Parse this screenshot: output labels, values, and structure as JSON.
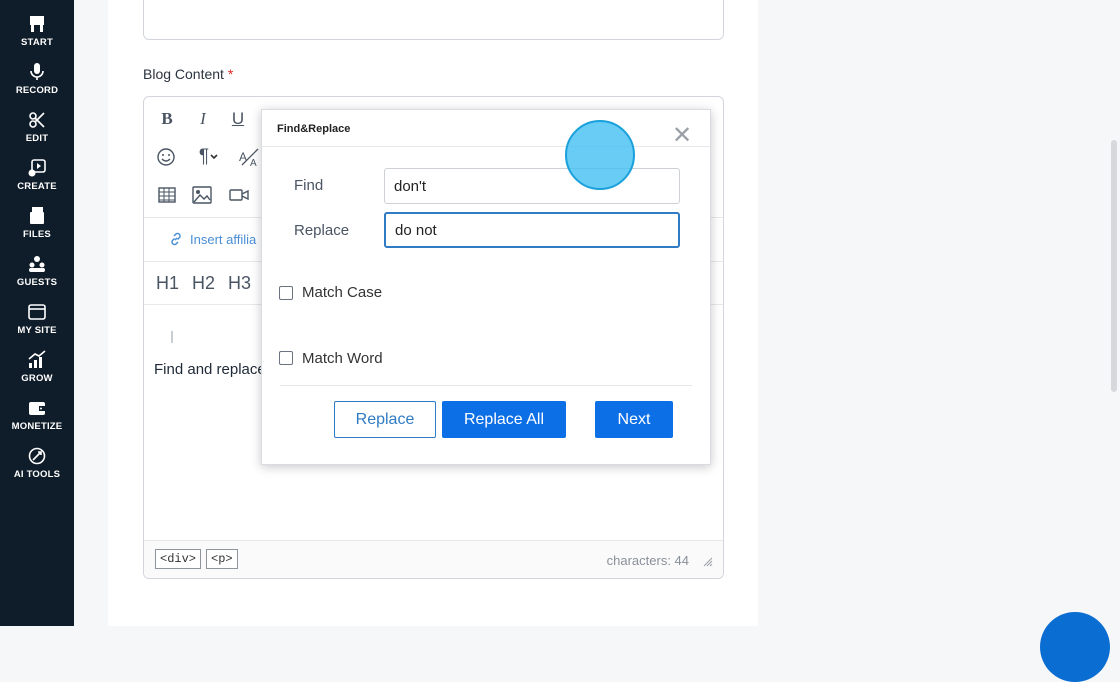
{
  "sidebar": {
    "items": [
      {
        "label": "START",
        "icon": "start-icon"
      },
      {
        "label": "RECORD",
        "icon": "microphone-icon"
      },
      {
        "label": "EDIT",
        "icon": "edit-icon"
      },
      {
        "label": "CREATE",
        "icon": "create-icon"
      },
      {
        "label": "FILES",
        "icon": "files-icon"
      },
      {
        "label": "GUESTS",
        "icon": "guests-icon"
      },
      {
        "label": "MY SITE",
        "icon": "my-site-icon"
      },
      {
        "label": "GROW",
        "icon": "grow-icon"
      },
      {
        "label": "MONETIZE",
        "icon": "monetize-icon"
      },
      {
        "label": "AI TOOLS",
        "icon": "ai-tools-icon"
      }
    ]
  },
  "form": {
    "blog_content_label": "Blog Content",
    "required_mark": "*"
  },
  "editor": {
    "toolbar": {
      "bold": "B",
      "italic": "I",
      "underline": "U"
    },
    "insert_affiliate": "Insert affilia",
    "headings": [
      "H1",
      "H2",
      "H3"
    ],
    "body_text": "Find and replace",
    "footer": {
      "tags": [
        "<div>",
        "<p>"
      ],
      "char_count": "characters: 44"
    }
  },
  "dialog": {
    "title": "Find&Replace",
    "close": "✕",
    "find_label": "Find",
    "find_value": "don't",
    "replace_label": "Replace",
    "replace_value": "do not",
    "match_case_label": "Match Case",
    "match_case_checked": false,
    "match_word_label": "Match Word",
    "match_word_checked": false,
    "replace_button": "Replace",
    "replace_all_button": "Replace All",
    "next_button": "Next"
  },
  "colors": {
    "sidebar_bg": "#0f1c29",
    "primary_button": "#0d6fe6",
    "focus_border": "#2f7bc4",
    "required": "#e02424",
    "cursor_highlight": "#3dbef2"
  }
}
